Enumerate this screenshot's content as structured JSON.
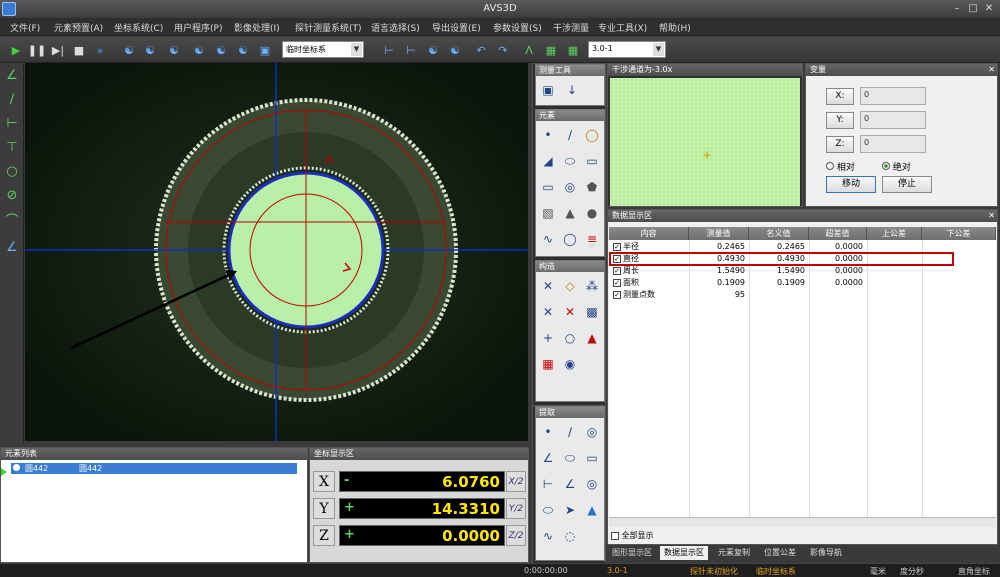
{
  "window": {
    "title": "AVS3D"
  },
  "menu": [
    "文件(F)",
    "元素预置(A)",
    "坐标系统(C)",
    "用户程序(P)",
    "影像处理(I)",
    "探针测量系统(T)",
    "语言选择(S)",
    "导出设置(E)",
    "参数设置(S)",
    "干涉测量",
    "专业工具(X)",
    "帮助(H)"
  ],
  "toolbar": {
    "coord_system": "临时坐标系",
    "zoom_combo": "3.0-1"
  },
  "panels": {
    "measure_tools": "测量工具",
    "elements": "元素",
    "construct": "构造",
    "extract": "提取",
    "interferometry": "干涉通道为-3.0x",
    "variables": "变量",
    "data_display": "数据显示区",
    "element_list": "元素列表",
    "coord_display": "坐标显示区"
  },
  "variables": {
    "x_label": "X:",
    "x_value": "0",
    "y_label": "Y:",
    "y_value": "0",
    "z_label": "Z:",
    "z_value": "0",
    "relative": "相对",
    "absolute": "绝对",
    "move": "移动",
    "stop": "停止"
  },
  "table": {
    "headers": [
      "内容",
      "测量值",
      "名义值",
      "超差值",
      "上公差",
      "下公差"
    ],
    "rows": [
      {
        "name": "半径",
        "measured": "0.2465",
        "nominal": "0.2465",
        "deviation": "0.0000"
      },
      {
        "name": "直径",
        "measured": "0.4930",
        "nominal": "0.4930",
        "deviation": "0.0000"
      },
      {
        "name": "周长",
        "measured": "1.5490",
        "nominal": "1.5490",
        "deviation": "0.0000"
      },
      {
        "name": "面积",
        "measured": "0.1909",
        "nominal": "0.1909",
        "deviation": "0.0000"
      },
      {
        "name": "测量点数",
        "measured": "95",
        "nominal": "",
        "deviation": ""
      }
    ],
    "show_all": "全部显示"
  },
  "element_list": {
    "item_id": "圆442",
    "item_name": "圆442"
  },
  "coords": {
    "x": {
      "axis": "X",
      "sign": "-",
      "value": "6.0760",
      "half": "X/2"
    },
    "y": {
      "axis": "Y",
      "sign": "+",
      "value": "14.3310",
      "half": "Y/2"
    },
    "z": {
      "axis": "Z",
      "sign": "+",
      "value": "0.0000",
      "half": "Z/2"
    }
  },
  "bottom_tabs": [
    "图形显示区",
    "数据显示区",
    "元素复制",
    "位置公差",
    "影像导航"
  ],
  "status": {
    "time": "0:00:00:00",
    "zoom": "3.0-1",
    "probe": "探针未初始化",
    "coord": "临时坐标系",
    "unit": "毫米",
    "angle": "度分秒",
    "system": "直角坐标"
  },
  "colors": {
    "accent_red": "#c00000",
    "fill_green": "#b8f0a8",
    "value_yellow": "#ffe600"
  }
}
